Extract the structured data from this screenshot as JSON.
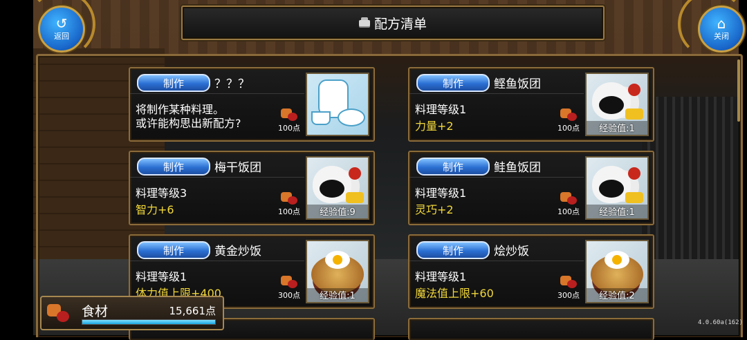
{
  "header": {
    "title": "配方清单",
    "back_label": "返回",
    "close_label": "关闭"
  },
  "recipes": [
    {
      "make_label": "制作",
      "name": "？？？",
      "desc": "将制作某种料理。\n或许能构思出新配方?",
      "level": "",
      "bonus": "",
      "cost": "100点",
      "exp": "",
      "thumb": "teaset-icon"
    },
    {
      "make_label": "制作",
      "name": "鲣鱼饭团",
      "desc": "",
      "level": "料理等级1",
      "bonus": "力量+2",
      "cost": "100点",
      "exp": "经验值:1",
      "thumb": "onigiri-icon"
    },
    {
      "make_label": "制作",
      "name": "梅干饭团",
      "desc": "",
      "level": "料理等级3",
      "bonus": "智力+6",
      "cost": "100点",
      "exp": "经验值:9",
      "thumb": "onigiri-icon"
    },
    {
      "make_label": "制作",
      "name": "鲑鱼饭团",
      "desc": "",
      "level": "料理等级1",
      "bonus": "灵巧+2",
      "cost": "100点",
      "exp": "经验值:1",
      "thumb": "onigiri-icon"
    },
    {
      "make_label": "制作",
      "name": "黄金炒饭",
      "desc": "",
      "level": "料理等级1",
      "bonus": "体力值上限+400",
      "cost": "300点",
      "exp": "经验值:1",
      "thumb": "fried-rice-icon"
    },
    {
      "make_label": "制作",
      "name": "烩炒饭",
      "desc": "",
      "level": "料理等级1",
      "bonus": "魔法值上限+60",
      "cost": "300点",
      "exp": "经验值:2",
      "thumb": "fried-rice-icon"
    }
  ],
  "ingredients": {
    "label": "食材",
    "amount": "15,661点",
    "gauge_fraction": 1.0
  },
  "version": "4.0.60a(162)",
  "colors": {
    "accent_blue": "#2b6fd3",
    "gold_frame": "#8c6c3a",
    "bonus_yellow": "#f2d83a"
  }
}
